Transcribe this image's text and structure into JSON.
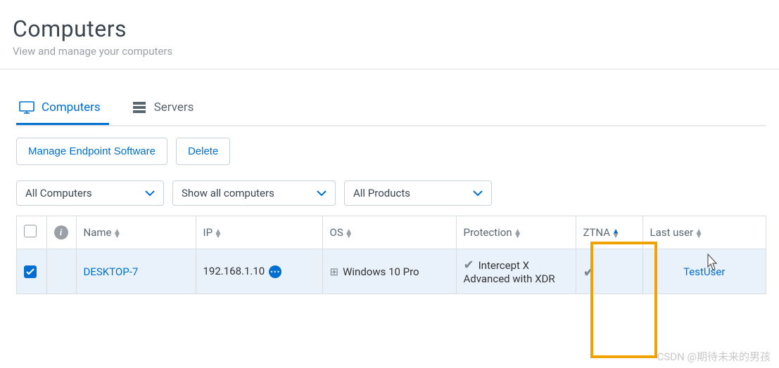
{
  "header": {
    "title": "Computers",
    "subtitle": "View and manage your computers"
  },
  "tabs": {
    "computers": "Computers",
    "servers": "Servers"
  },
  "actions": {
    "manage": "Manage Endpoint Software",
    "delete": "Delete"
  },
  "filters": {
    "group": "All Computers",
    "status": "Show all computers",
    "products": "All Products"
  },
  "columns": {
    "name": "Name",
    "ip": "IP",
    "os": "OS",
    "protection": "Protection",
    "ztna": "ZTNA",
    "lastuser": "Last user"
  },
  "rows": [
    {
      "selected": true,
      "name": "DESKTOP-7",
      "ip": "192.168.1.10",
      "os": "Windows 10 Pro",
      "protection": "Intercept X Advanced with XDR",
      "ztna_enabled": true,
      "last_user": "TestUser"
    }
  ],
  "watermark": "CSDN @期待未来的男孩"
}
